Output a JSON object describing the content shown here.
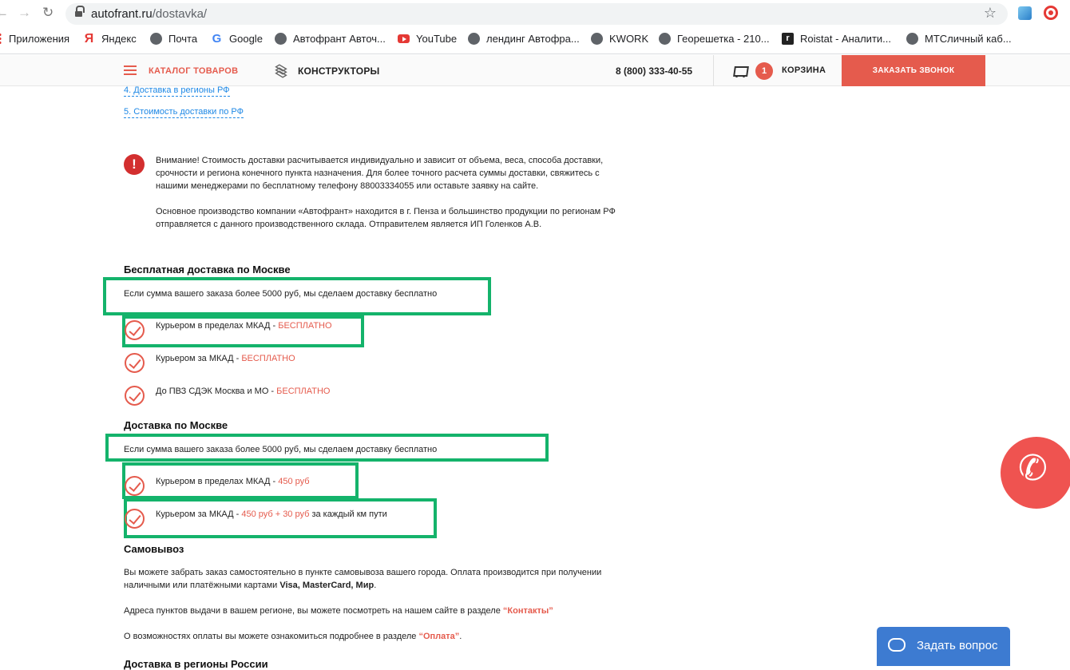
{
  "browser": {
    "url_domain": "autofrant.ru",
    "url_path": "/dostavka/",
    "bookmarks": [
      {
        "label": "Приложения",
        "icon": "apps-icon"
      },
      {
        "label": "Яндекс",
        "icon": "yandex-icon"
      },
      {
        "label": "Почта",
        "icon": "globe-icon"
      },
      {
        "label": "Google",
        "icon": "google-icon"
      },
      {
        "label": "Автофрант Авточ...",
        "icon": "globe-icon"
      },
      {
        "label": "YouTube",
        "icon": "youtube-icon"
      },
      {
        "label": "лендинг Автофра...",
        "icon": "globe-icon"
      },
      {
        "label": "KWORK",
        "icon": "globe-icon"
      },
      {
        "label": "Георешетка - 210...",
        "icon": "globe-icon"
      },
      {
        "label": "Roistat - Аналити...",
        "icon": "roistat-icon"
      },
      {
        "label": "МТСличный каб...",
        "icon": "globe-icon"
      }
    ]
  },
  "header": {
    "catalog": "КАТАЛОГ ТОВАРОВ",
    "constructors": "КОНСТРУКТОРЫ",
    "phone": "8 (800) 333-40-55",
    "cart_count": "1",
    "cart_label": "КОРЗИНА",
    "callback": "ЗАКАЗАТЬ ЗВОНОК"
  },
  "toc": [
    "4. Доставка в регионы РФ",
    "5. Стоимость доставки по РФ"
  ],
  "warning": {
    "line1": "Внимание! Стоимость доставки расчитывается индивидуально и зависит от объема, веса, способа доставки,",
    "line2": "срочности и региона конечного пункта назначения. Для более точного расчета суммы доставки, свяжитесь с",
    "line3": "нашими менеджерами по бесплатному телефону 88003334055 или оставьте заявку на сайте.",
    "line4": "Основное производство компании «Автофрант» находится в г. Пенза и большинство продукции по регионам РФ",
    "line5": "отправляется с данного производственного склада. Отправителем является ИП Голенков А.В."
  },
  "free_moscow": {
    "title": "Бесплатная доставка по Москве",
    "note": "Если сумма вашего заказа более 5000 руб, мы сделаем доставку бесплатно",
    "items": [
      {
        "text": "Курьером в пределах МКАД - ",
        "accent": "БЕСПЛАТНО"
      },
      {
        "text": "Курьером за МКАД - ",
        "accent": "БЕСПЛАТНО"
      },
      {
        "text": "До ПВЗ СДЭК Москва и МО - ",
        "accent": "БЕСПЛАТНО"
      }
    ]
  },
  "moscow": {
    "title": "Доставка по Москве",
    "note": "Если сумма вашего заказа более 5000 руб, мы сделаем доставку бесплатно",
    "items": [
      {
        "text": "Курьером в пределах МКАД - ",
        "accent": "450 руб",
        "tail": ""
      },
      {
        "text": "Курьером за МКАД - ",
        "accent": "450 руб + 30 руб",
        "tail": " за каждый км пути"
      }
    ]
  },
  "pickup": {
    "title": "Самовывоз",
    "p1_line1": "Вы можете забрать заказ самостоятельно в пункте самовывоза вашего города. Оплата производится при получении",
    "p1_line2_a": "наличными или платёжными картами ",
    "p1_line2_b": "Visa, MasterCard, Мир",
    "p1_line2_c": ".",
    "p2_a": "Адреса пунктов выдачи в вашем регионе, вы можете посмотреть на нашем сайте в разделе ",
    "p2_link": "“Контакты”",
    "p3_a": "О возможностях оплаты вы можете ознакомиться подробнее в разделе ",
    "p3_link": "“Оплата”",
    "p3_c": "."
  },
  "next_heading": "Доставка в регионы России",
  "widgets": {
    "chat": "Задать вопрос"
  },
  "colors": {
    "accent": "#e55b4d",
    "highlight": "#14b36b",
    "link": "#1e88e5",
    "chat": "#3d7bd1"
  }
}
